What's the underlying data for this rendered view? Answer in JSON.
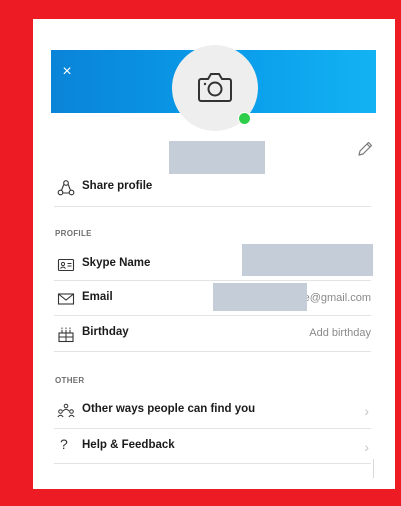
{
  "header": {
    "close_icon": "×"
  },
  "profile": {
    "share_label": "Share profile"
  },
  "sections": {
    "profile_title": "PROFILE",
    "other_title": "OTHER"
  },
  "fields": {
    "skype_name_label": "Skype Name",
    "email_label": "Email",
    "email_value": "e@gmail.com",
    "birthday_label": "Birthday",
    "birthday_value": "Add birthday"
  },
  "other": {
    "find_you_label": "Other ways people can find you",
    "help_label": "Help & Feedback"
  },
  "colors": {
    "frame": "#ed1c24",
    "header_blue": "#0a9cea",
    "presence": "#2fce4a",
    "redaction": "#c5cdd8"
  },
  "icons": [
    "close-icon",
    "camera-icon",
    "pencil-icon",
    "share-profile-icon",
    "contact-card-icon",
    "envelope-icon",
    "birthday-cake-icon",
    "people-group-icon",
    "question-icon",
    "chevron-right-icon"
  ]
}
